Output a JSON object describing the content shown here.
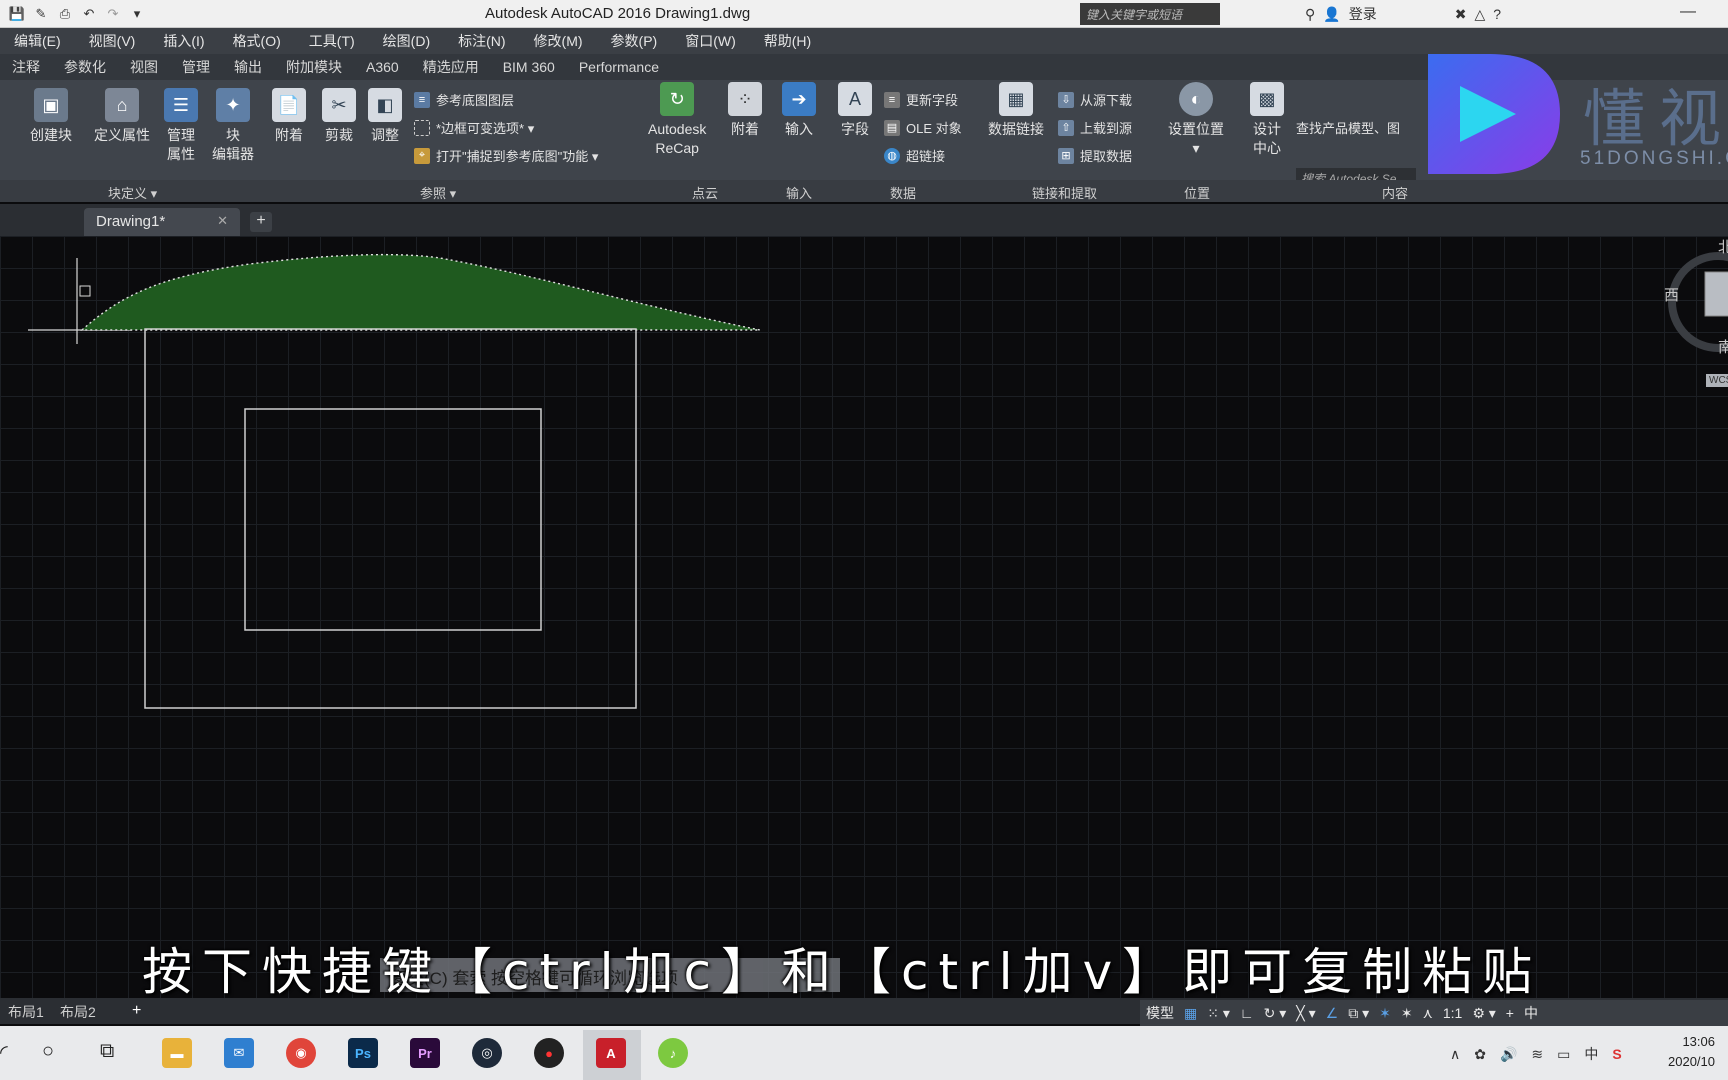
{
  "window": {
    "title": "Autodesk AutoCAD 2016    Drawing1.dwg",
    "search_placeholder": "键入关键字或短语",
    "login_label": "登录"
  },
  "menu": [
    "编辑(E)",
    "视图(V)",
    "插入(I)",
    "格式(O)",
    "工具(T)",
    "绘图(D)",
    "标注(N)",
    "修改(M)",
    "参数(P)",
    "窗口(W)",
    "帮助(H)"
  ],
  "ribbon_tabs": [
    "注释",
    "参数化",
    "视图",
    "管理",
    "输出",
    "附加模块",
    "A360",
    "精选应用",
    "BIM 360",
    "Performance"
  ],
  "ribbon": {
    "block": {
      "create": "创建块",
      "define_attr": "定义属性",
      "manage_attr_1": "管理",
      "manage_attr_2": "属性",
      "block_editor_1": "块",
      "block_editor_2": "编辑器",
      "label": "块定义 ▾"
    },
    "reference": {
      "attach": "附着",
      "clip": "剪裁",
      "adjust": "调整",
      "underlay_layers": "参考底图图层",
      "frame_var": "*边框可变选项* ▾",
      "snap_underlay": "打开\"捕捉到参考底图\"功能 ▾",
      "label": "参照 ▾"
    },
    "pointcloud": {
      "recap_1": "Autodesk",
      "recap_2": "ReCap",
      "attach": "附着",
      "label": "点云"
    },
    "import": {
      "import": "输入",
      "label": "输入"
    },
    "data": {
      "field": "字段",
      "update_fields": "更新字段",
      "ole": "OLE 对象",
      "hyperlink": "超链接",
      "label": "数据"
    },
    "linking": {
      "data_link": "数据链接",
      "download_source": "从源下载",
      "upload_source": "上载到源",
      "extract": "提取数据",
      "label": "链接和提取"
    },
    "location": {
      "set_location": "设置位置",
      "label": "位置"
    },
    "content": {
      "design_center_1": "设计",
      "design_center_2": "中心",
      "search_placeholder": "搜索 Autodesk Se",
      "find_models": "查找产品模型、图",
      "label": "内容"
    }
  },
  "logo": {
    "cn": "懂视",
    "en": "51DONGSHI.COM"
  },
  "file_tab": {
    "name": "Drawing1*"
  },
  "viewcube": {
    "west": "西",
    "south": "南",
    "north": "北",
    "wcs": "WCS"
  },
  "subtitle": "按下快捷键【ctrl加c】和【ctrl加v】即可复制粘贴",
  "command_line": "窗交(C) 套索 按空格键可循环浏览选项",
  "layout_tabs": [
    "布局1",
    "布局2"
  ],
  "status": {
    "model": "模型",
    "scale": "1:1",
    "ime": "中"
  },
  "taskbar": {
    "apps": [
      "文件资源管理器",
      "邮件",
      "Chrome",
      "Ps",
      "Pr",
      "Cinema 4D",
      "录屏",
      "AutoCAD",
      "音乐"
    ],
    "tray_ime": "中",
    "time": "13:06",
    "date": "2020/10"
  },
  "colors": {
    "hatch": "#1f5a1f",
    "grid": "#1c1f24",
    "ribbon": "#3f444b",
    "accent": "#5aa0e6"
  }
}
